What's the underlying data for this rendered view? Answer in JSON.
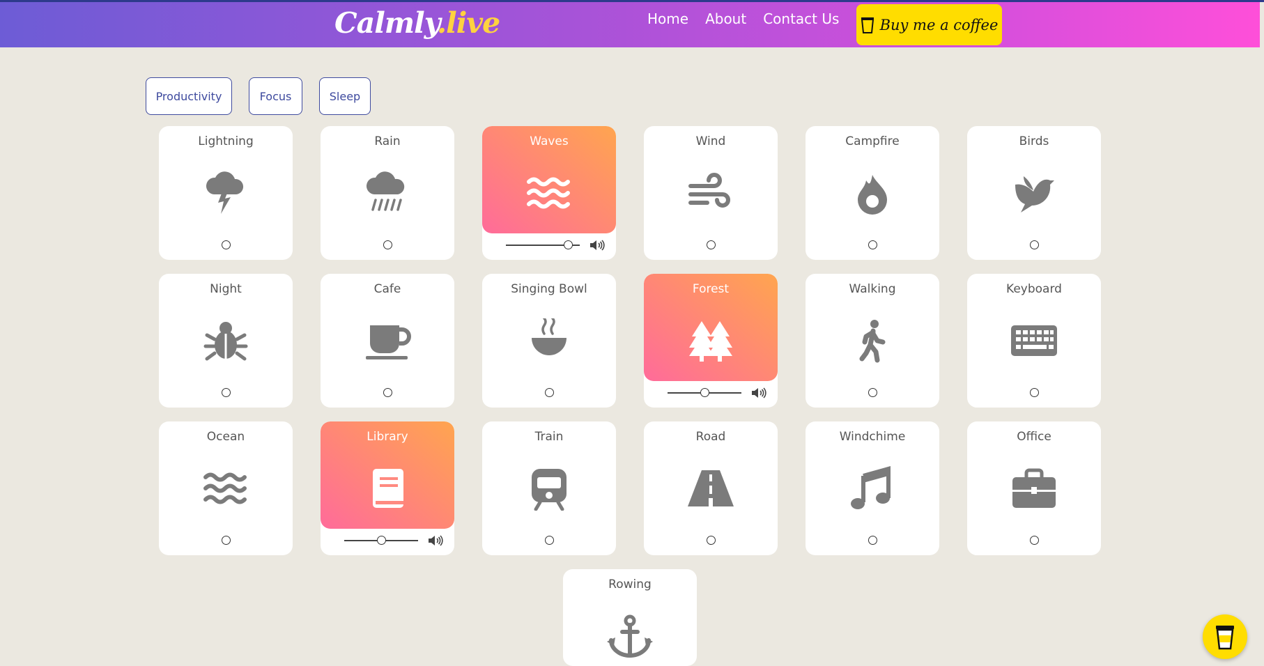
{
  "header": {
    "logo_main": "Calmly",
    "logo_accent": ".live",
    "nav": [
      "Home",
      "About",
      "Contact Us"
    ],
    "coffee_label": "Buy me a coffee"
  },
  "filters": [
    "Productivity",
    "Focus",
    "Sleep"
  ],
  "sounds": [
    {
      "label": "Lightning",
      "icon": "thunderstorm-icon",
      "active": false
    },
    {
      "label": "Rain",
      "icon": "rain-cloud-icon",
      "active": false
    },
    {
      "label": "Waves",
      "icon": "water-icon",
      "active": true,
      "volume": 0.84
    },
    {
      "label": "Wind",
      "icon": "wind-icon",
      "active": false
    },
    {
      "label": "Campfire",
      "icon": "fire-icon",
      "active": false
    },
    {
      "label": "Birds",
      "icon": "dove-icon",
      "active": false
    },
    {
      "label": "Night",
      "icon": "bug-icon",
      "active": false
    },
    {
      "label": "Cafe",
      "icon": "coffee-cup-icon",
      "active": false
    },
    {
      "label": "Singing Bowl",
      "icon": "bowl-icon",
      "active": false
    },
    {
      "label": "Forest",
      "icon": "trees-icon",
      "active": true,
      "volume": 0.5
    },
    {
      "label": "Walking",
      "icon": "walking-person-icon",
      "active": false
    },
    {
      "label": "Keyboard",
      "icon": "keyboard-icon",
      "active": false
    },
    {
      "label": "Ocean",
      "icon": "water-icon",
      "active": false
    },
    {
      "label": "Library",
      "icon": "book-icon",
      "active": true,
      "volume": 0.5
    },
    {
      "label": "Train",
      "icon": "train-icon",
      "active": false
    },
    {
      "label": "Road",
      "icon": "road-icon",
      "active": false
    },
    {
      "label": "Windchime",
      "icon": "music-note-icon",
      "active": false
    },
    {
      "label": "Office",
      "icon": "briefcase-icon",
      "active": false
    },
    {
      "label": "Rowing",
      "icon": "anchor-icon",
      "active": false
    }
  ],
  "colors": {
    "active_start": "#ff6b9a",
    "active_end": "#ffa54f",
    "coffee": "#ffdd00"
  }
}
